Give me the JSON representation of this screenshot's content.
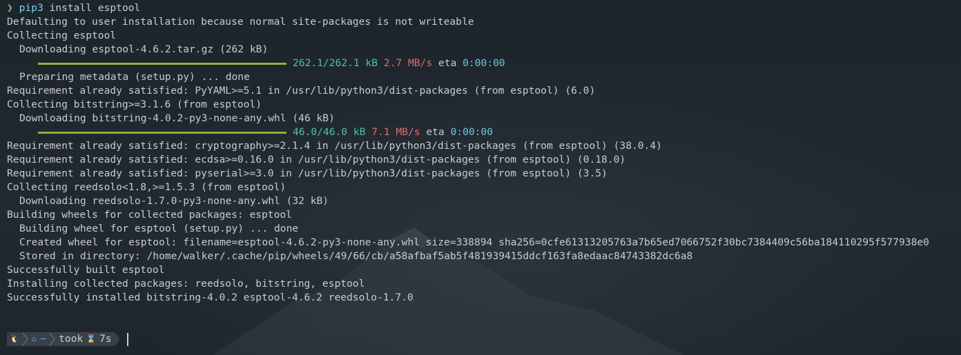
{
  "prompt": {
    "arrow": "❯",
    "command_name": "pip3",
    "command_args": " install esptool"
  },
  "output": {
    "l1": "Defaulting to user installation because normal site-packages is not writeable",
    "l2": "Collecting esptool",
    "l3": "Downloading esptool-4.6.2.tar.gz (262 kB)",
    "bar1": {
      "size": "262.1/262.1 kB",
      "speed": "2.7 MB/s",
      "eta_label": "eta",
      "eta": "0:00:00",
      "progress": 1.0
    },
    "l4": "Preparing metadata (setup.py) ... done",
    "l5": "Requirement already satisfied: PyYAML>=5.1 in /usr/lib/python3/dist-packages (from esptool) (6.0)",
    "l6": "Collecting bitstring>=3.1.6 (from esptool)",
    "l7": "Downloading bitstring-4.0.2-py3-none-any.whl (46 kB)",
    "bar2": {
      "size": "46.0/46.0 kB",
      "speed": "7.1 MB/s",
      "eta_label": "eta",
      "eta": "0:00:00",
      "progress": 1.0
    },
    "l8": "Requirement already satisfied: cryptography>=2.1.4 in /usr/lib/python3/dist-packages (from esptool) (38.0.4)",
    "l9": "Requirement already satisfied: ecdsa>=0.16.0 in /usr/lib/python3/dist-packages (from esptool) (0.18.0)",
    "l10": "Requirement already satisfied: pyserial>=3.0 in /usr/lib/python3/dist-packages (from esptool) (3.5)",
    "l11": "Collecting reedsolo<1.8,>=1.5.3 (from esptool)",
    "l12": "Downloading reedsolo-1.7.0-py3-none-any.whl (32 kB)",
    "l13": "Building wheels for collected packages: esptool",
    "l14": "Building wheel for esptool (setup.py) ... done",
    "l15": "Created wheel for esptool: filename=esptool-4.6.2-py3-none-any.whl size=338894 sha256=0cfe61313205763a7b65ed7066752f30bc7384409c56ba184110295f577938e0",
    "l16": "Stored in directory: /home/walker/.cache/pip/wheels/49/66/cb/a58afbaf5ab5f481939415ddcf163fa8edaac84743382dc6a8",
    "l17": "Successfully built esptool",
    "l18": "Installing collected packages: reedsolo, bitstring, esptool",
    "l19": "Successfully installed bitstring-4.0.2 esptool-4.6.2 reedsolo-1.7.0"
  },
  "statusline": {
    "os_icon": "linux-icon",
    "home_icon": "home-icon",
    "path": "~",
    "took_label": "took",
    "hourglass_icon": "hourglass-icon",
    "duration": "7s"
  },
  "colors": {
    "background": "#1f252d",
    "text": "#c8ccd4",
    "progress_bar": "#8fb13a",
    "size": "#4fc3a1",
    "speed": "#e26d6d",
    "eta": "#6fc3df",
    "segment": "#3a4048"
  }
}
